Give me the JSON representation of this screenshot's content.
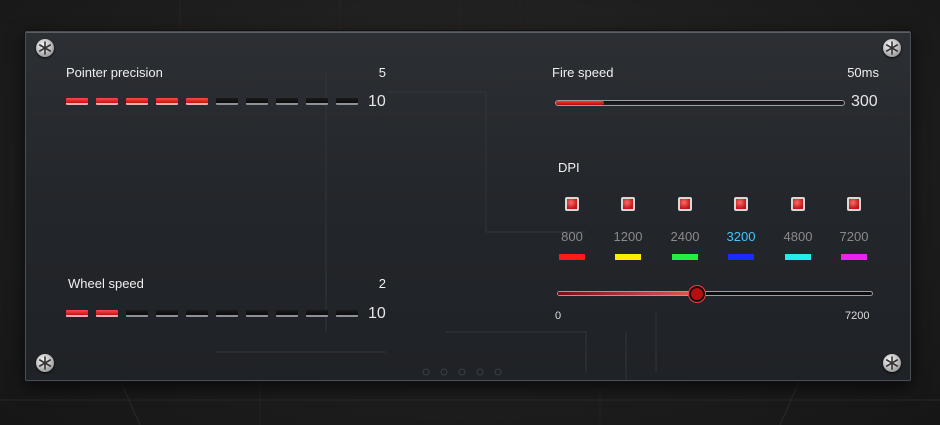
{
  "pointer_precision": {
    "label": "Pointer precision",
    "value": "5",
    "max": "10",
    "level": 5,
    "segments": 10
  },
  "wheel_speed": {
    "label": "Wheel speed",
    "value": "2",
    "max": "10",
    "level": 2,
    "segments": 10
  },
  "fire_speed": {
    "label": "Fire speed",
    "value": "50ms",
    "max": "300",
    "fill_fraction": 0.167
  },
  "dpi": {
    "label": "DPI",
    "levels": [
      {
        "value": "800",
        "color": "#ff1a1a",
        "checked": true
      },
      {
        "value": "1200",
        "color": "#ffee00",
        "checked": true
      },
      {
        "value": "2400",
        "color": "#22ee44",
        "checked": true
      },
      {
        "value": "3200",
        "color": "#1a2bff",
        "checked": true,
        "active": true
      },
      {
        "value": "4800",
        "color": "#22eeee",
        "checked": true
      },
      {
        "value": "7200",
        "color": "#ee22ee",
        "checked": true
      }
    ],
    "slider": {
      "min": "0",
      "max": "7200",
      "current": 3200
    },
    "active_color": "#3ec8ff"
  },
  "colors": {
    "accent": "#d01515",
    "panel": "#262a2e"
  }
}
